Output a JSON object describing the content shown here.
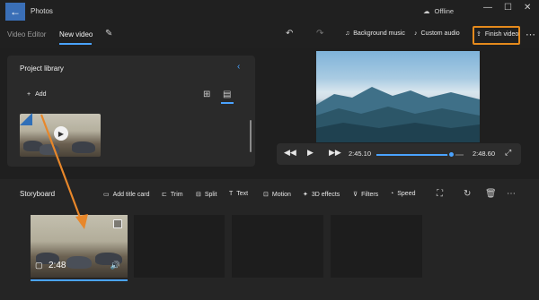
{
  "app": {
    "title": "Photos",
    "status": "Offline"
  },
  "toolbar": {
    "breadcrumb_parent": "Video Editor",
    "breadcrumb_current": "New video",
    "background_music": "Background music",
    "custom_audio": "Custom audio",
    "finish_video": "Finish video"
  },
  "library": {
    "title": "Project library",
    "add_label": "Add"
  },
  "player": {
    "current_time": "2:45.10",
    "total_time": "2:48.60",
    "progress": 0.86
  },
  "storyboard": {
    "title": "Storyboard",
    "tools": {
      "add_title_card": "Add title card",
      "trim": "Trim",
      "split": "Split",
      "text": "Text",
      "motion": "Motion",
      "effects_3d": "3D effects",
      "filters": "Filters",
      "speed": "Speed"
    },
    "clips": [
      {
        "duration": "2:48"
      }
    ]
  },
  "colors": {
    "accent": "#4aa3ff",
    "highlight": "#e58a1c"
  }
}
